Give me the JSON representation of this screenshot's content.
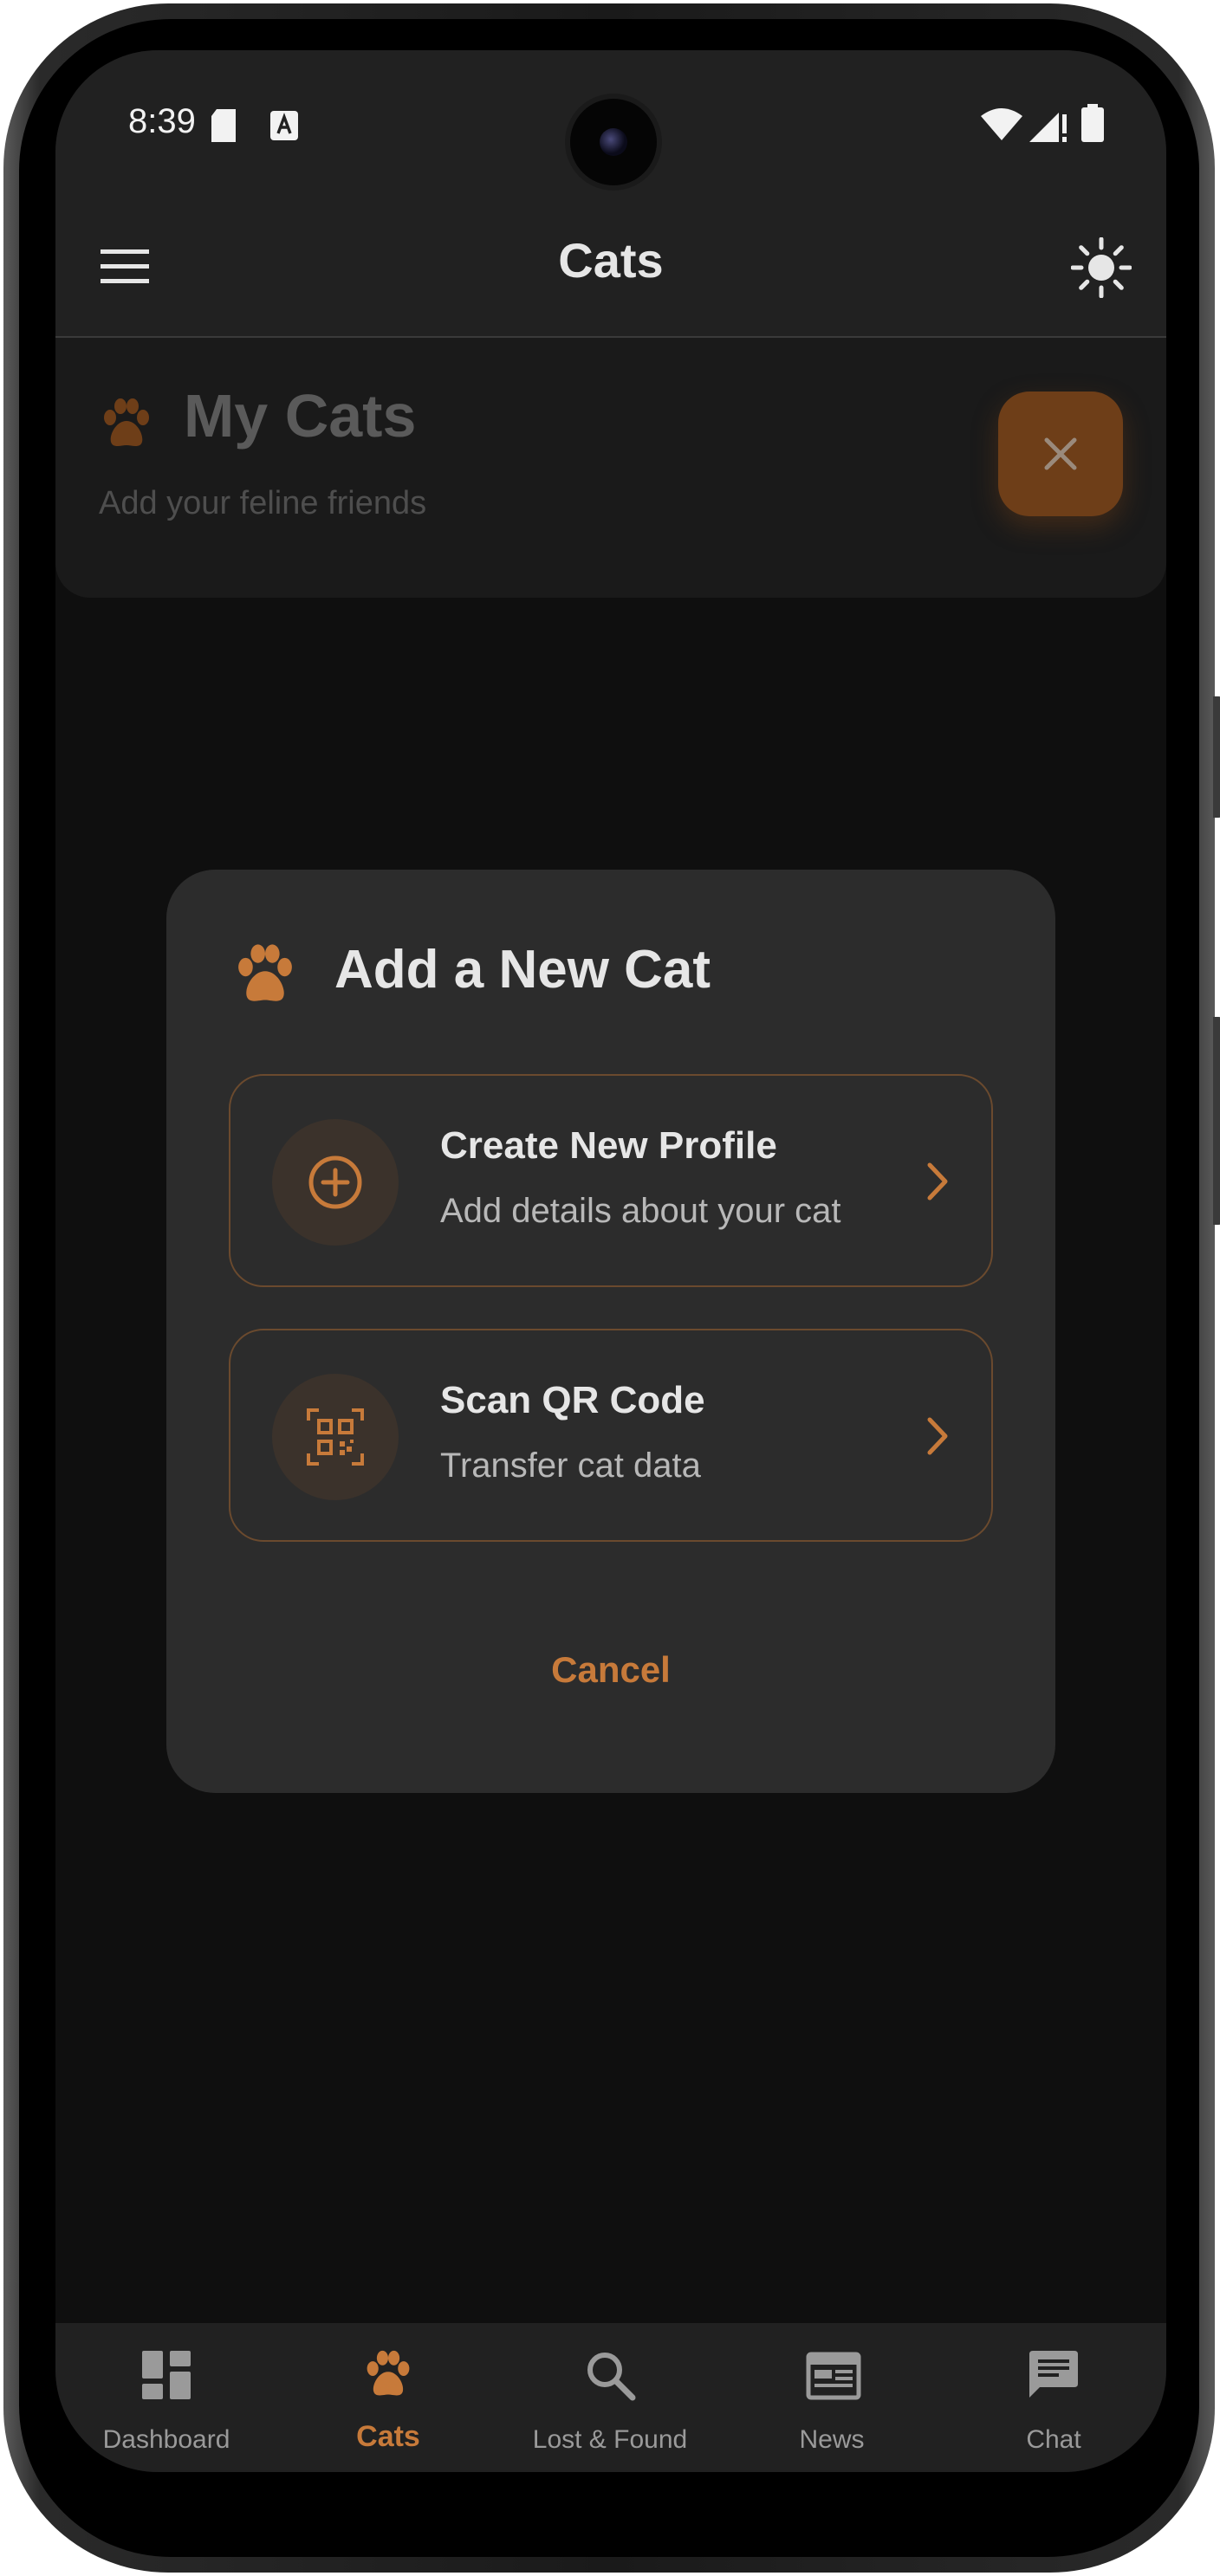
{
  "status_bar": {
    "time": "8:39"
  },
  "app_bar": {
    "title": "Cats",
    "menu_icon": "hamburger-menu-icon",
    "theme_icon": "sun-icon"
  },
  "header": {
    "title": "My Cats",
    "subtitle": "Add your feline friends"
  },
  "dialog": {
    "title": "Add a New Cat",
    "options": [
      {
        "title": "Create New Profile",
        "subtitle": "Add details about your cat",
        "icon": "plus-circle-icon"
      },
      {
        "title": "Scan QR Code",
        "subtitle": "Transfer cat data",
        "icon": "qr-code-icon"
      }
    ],
    "cancel_label": "Cancel"
  },
  "bottom_nav": {
    "items": [
      {
        "label": "Dashboard",
        "icon": "dashboard-icon"
      },
      {
        "label": "Cats",
        "icon": "paw-icon",
        "active": true
      },
      {
        "label": "Lost & Found",
        "icon": "search-icon"
      },
      {
        "label": "News",
        "icon": "news-icon"
      },
      {
        "label": "Chat",
        "icon": "chat-icon"
      }
    ]
  },
  "colors": {
    "accent": "#c77a3a",
    "surface": "#212121",
    "background": "#0f0f0f",
    "dialog": "#2c2c2c"
  }
}
